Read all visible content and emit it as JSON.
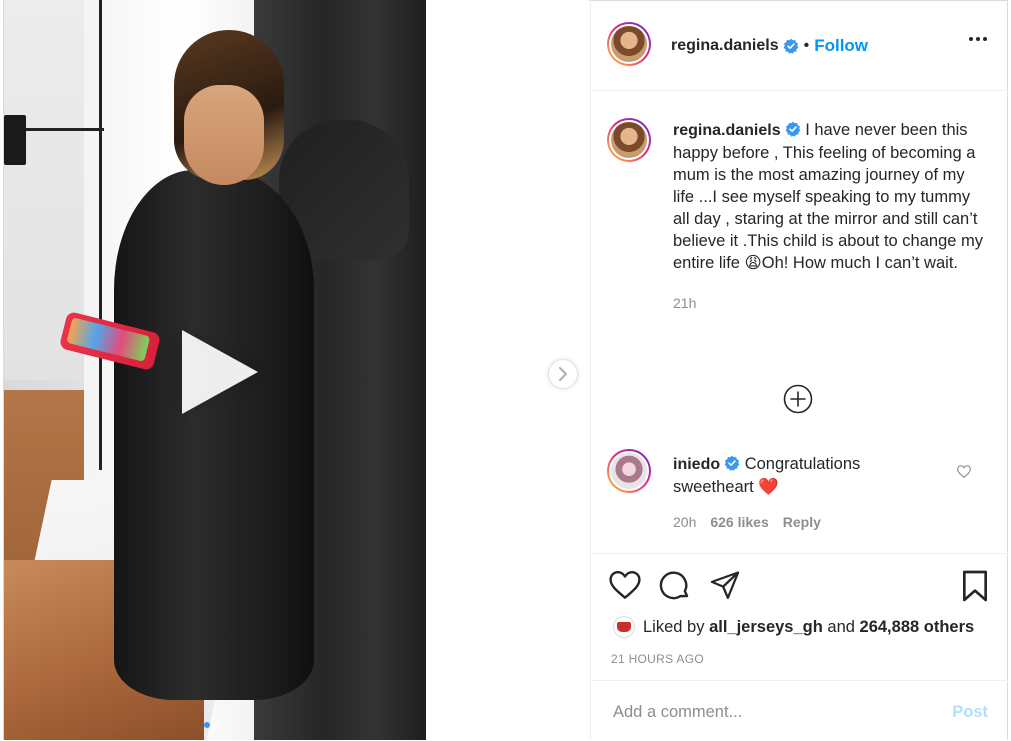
{
  "post": {
    "username": "regina.daniels",
    "follow_label": "Follow",
    "more_label": "•••",
    "caption_username": "regina.daniels",
    "caption_part1": "I have never been this happy before , This feeling of becoming a mum is the most amazing journey of my life ...I see myself speaking to my tummy all day , staring at the mirror and still can’t believe it .This child is about to change my entire life ",
    "caption_emoji": "😩",
    "caption_part2": "Oh! How much I can’t wait.",
    "caption_time": "21h",
    "likes_prefix": "Liked by",
    "likes_user": "all_jerseys_gh",
    "likes_and": "and",
    "likes_others": "264,888 others",
    "posted_ago": "21 HOURS AGO"
  },
  "media": {
    "carousel_count": 2,
    "active_index": 0
  },
  "comments": [
    {
      "username": "iniedo",
      "text": "Congratulations sweetheart",
      "emoji": "❤️",
      "time": "20h",
      "likes": "626 likes",
      "reply_label": "Reply"
    }
  ],
  "composer": {
    "placeholder": "Add a comment...",
    "post_label": "Post"
  },
  "colors": {
    "accent": "#0095f6",
    "verified": "#3897f0",
    "post_disabled": "#b2dffc"
  },
  "icons": [
    "verified-icon",
    "more-icon",
    "add-circle-icon",
    "heart-icon",
    "comment-icon",
    "share-icon",
    "bookmark-icon",
    "play-icon",
    "chevron-right-icon"
  ]
}
